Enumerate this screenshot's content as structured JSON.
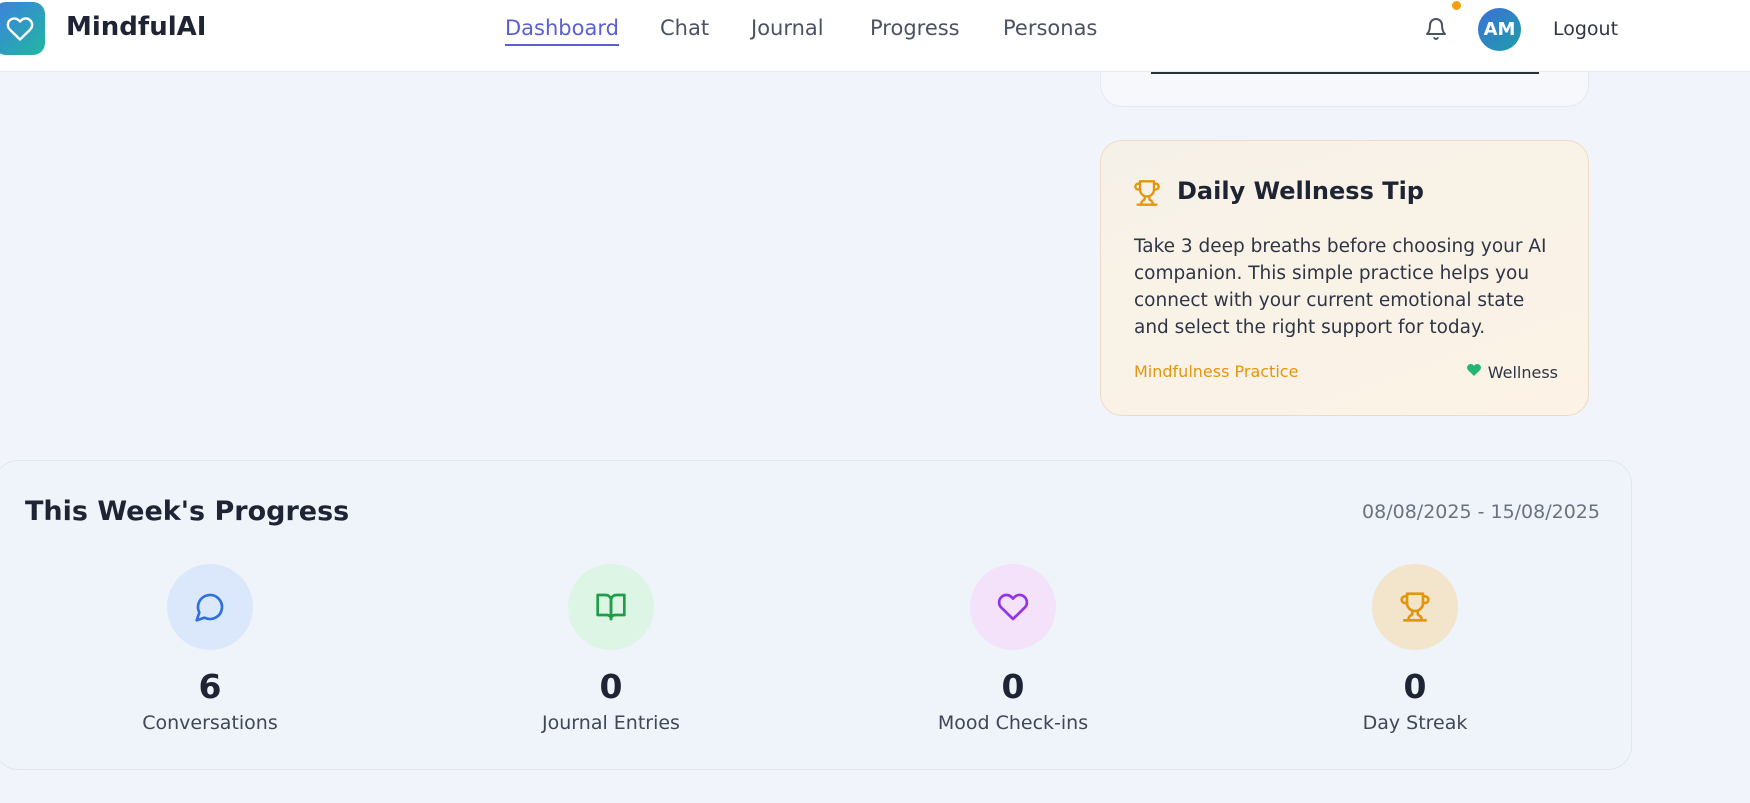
{
  "header": {
    "brand": "MindfulAI",
    "nav": [
      {
        "label": "Dashboard",
        "active": true
      },
      {
        "label": "Chat",
        "active": false
      },
      {
        "label": "Journal",
        "active": false
      },
      {
        "label": "Progress",
        "active": false
      },
      {
        "label": "Personas",
        "active": false
      }
    ],
    "avatar_initials": "AM",
    "logout_label": "Logout",
    "notification_dot": true
  },
  "tip": {
    "title": "Daily Wellness Tip",
    "body": "Take 3 deep breaths before choosing your AI companion. This simple practice helps you connect with your current emotional state and select the right support for today.",
    "tag": "Mindfulness Practice",
    "category": "Wellness"
  },
  "progress": {
    "title": "This Week's Progress",
    "date_range": "08/08/2025 - 15/08/2025",
    "stats": [
      {
        "icon": "chat-bubble-icon",
        "value": "6",
        "label": "Conversations"
      },
      {
        "icon": "book-open-icon",
        "value": "0",
        "label": "Journal Entries"
      },
      {
        "icon": "heart-icon",
        "value": "0",
        "label": "Mood Check-ins"
      },
      {
        "icon": "trophy-icon",
        "value": "0",
        "label": "Day Streak"
      }
    ]
  },
  "colors": {
    "accent": "#5a5fd6",
    "warning": "#f59e0b",
    "chat_bg": "#dbe8fb",
    "journal_bg": "#dcf5e4",
    "mood_bg": "#f3e2fa",
    "streak_bg": "#f3e4cc"
  }
}
